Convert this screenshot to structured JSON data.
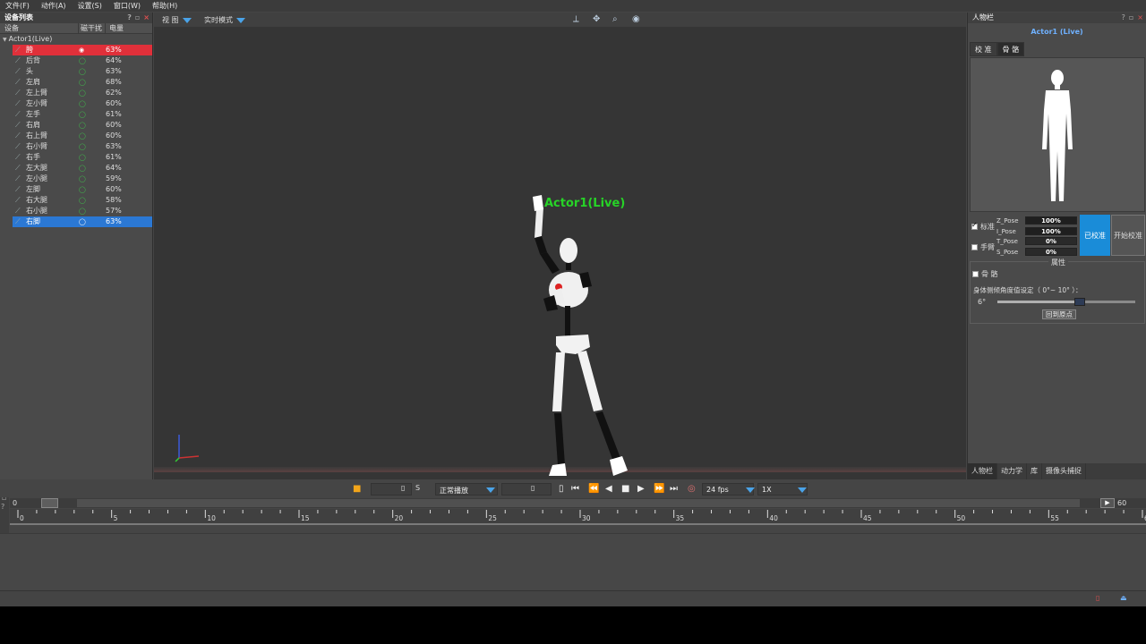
{
  "menu": [
    "文件(F)",
    "动作(A)",
    "设置(S)",
    "窗口(W)",
    "帮助(H)"
  ],
  "device_panel": {
    "title": "设备列表",
    "columns": [
      "设备",
      "磁干扰",
      "电量"
    ],
    "actor": "Actor1(Live)",
    "devices": [
      {
        "name": "胯",
        "battery": "63%",
        "state": "red"
      },
      {
        "name": "后背",
        "battery": "64%"
      },
      {
        "name": "头",
        "battery": "63%"
      },
      {
        "name": "左肩",
        "battery": "68%"
      },
      {
        "name": "左上臂",
        "battery": "62%"
      },
      {
        "name": "左小臂",
        "battery": "60%"
      },
      {
        "name": "左手",
        "battery": "61%"
      },
      {
        "name": "右肩",
        "battery": "60%"
      },
      {
        "name": "右上臂",
        "battery": "60%"
      },
      {
        "name": "右小臂",
        "battery": "63%"
      },
      {
        "name": "右手",
        "battery": "61%"
      },
      {
        "name": "左大腿",
        "battery": "64%"
      },
      {
        "name": "左小腿",
        "battery": "59%"
      },
      {
        "name": "左脚",
        "battery": "60%"
      },
      {
        "name": "右大腿",
        "battery": "58%"
      },
      {
        "name": "右小腿",
        "battery": "57%"
      },
      {
        "name": "右脚",
        "battery": "63%",
        "state": "blue"
      }
    ]
  },
  "viewport": {
    "view_dropdown": "视 图",
    "mode_dropdown": "实时模式",
    "actor_label": "Actor1(Live)"
  },
  "right_panel": {
    "title": "人物栏",
    "actor_name": "Actor1 (Live)",
    "tabs": [
      "校 准",
      "骨 骼"
    ],
    "calib": {
      "standard_label": "标准",
      "hand_label": "手臂",
      "poses": [
        {
          "name": "Z_Pose",
          "value": "100%"
        },
        {
          "name": "I_Pose",
          "value": "100%"
        },
        {
          "name": "T_Pose",
          "value": "0%"
        },
        {
          "name": "S_Pose",
          "value": "0%"
        }
      ],
      "calibrated_btn": "已校准",
      "start_btn": "开始校准"
    },
    "attributes": {
      "title": "属性",
      "skeleton_label": "骨 骼",
      "angle_label": "身体侧倾角度值设定（ 0°~ 10° ）：",
      "angle_value": "6°",
      "slider_fraction": 0.6,
      "reset_btn": "回到原点"
    },
    "bottom_tabs": [
      "人物栏",
      "动力学",
      "库",
      "摄像头捕捉"
    ]
  },
  "playback": {
    "unit": "S",
    "play_mode": "正常播放",
    "fps": "24 fps",
    "speed": "1X"
  },
  "timeline": {
    "start": "0",
    "end": "60",
    "ticks": [
      "0",
      "5",
      "10",
      "15",
      "20",
      "25",
      "30",
      "35",
      "40",
      "45",
      "50",
      "55",
      "60"
    ]
  }
}
